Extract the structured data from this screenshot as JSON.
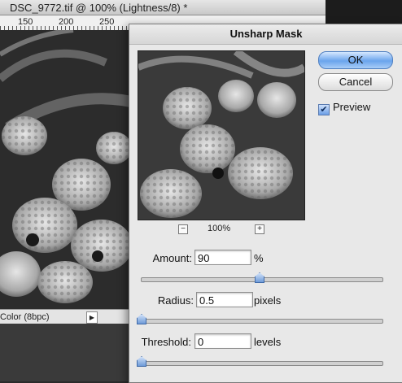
{
  "document": {
    "title": "DSC_9772.tif @ 100% (Lightness/8) *",
    "ruler_labels": [
      "150",
      "200",
      "250"
    ],
    "status_text": "Color (8bpc)"
  },
  "dialog": {
    "title": "Unsharp Mask",
    "ok_label": "OK",
    "cancel_label": "Cancel",
    "preview_label": "Preview",
    "preview_checked": true,
    "zoom_out_label": "−",
    "zoom_in_label": "+",
    "zoom_level": "100%",
    "amount": {
      "label": "Amount:",
      "value": "90",
      "unit": "%",
      "slider_fraction": 0.49
    },
    "radius": {
      "label": "Radius:",
      "value": "0.5",
      "unit": "pixels",
      "slider_fraction": 0.0
    },
    "threshold": {
      "label": "Threshold:",
      "value": "0",
      "unit": "levels",
      "slider_fraction": 0.0
    }
  },
  "colors": {
    "ok_button": "#6aa4ec",
    "dialog_bg": "#e8e8e8"
  }
}
